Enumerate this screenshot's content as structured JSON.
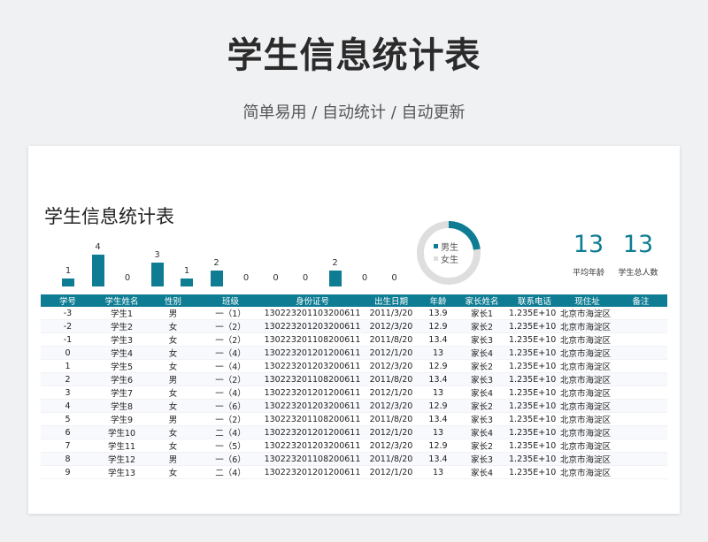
{
  "header": {
    "title": "学生信息统计表",
    "subtitle": "简单易用 / 自动统计 / 自动更新"
  },
  "sheet": {
    "title": "学生信息统计表"
  },
  "chart_data": [
    {
      "type": "bar",
      "values": [
        1,
        4,
        0,
        3,
        1,
        2,
        0,
        0,
        0,
        2,
        0,
        0
      ],
      "color": "#0e7c93"
    },
    {
      "type": "pie",
      "labels": [
        "男生",
        "女生"
      ],
      "values": [
        3,
        10
      ],
      "colors": [
        "#0e7c93",
        "#dedede"
      ]
    }
  ],
  "stats": {
    "avg_age_value": "13",
    "avg_age_label": "平均年龄",
    "total_value": "13",
    "total_label": "学生总人数"
  },
  "table": {
    "columns": [
      "学号",
      "学生姓名",
      "性别",
      "班级",
      "身份证号",
      "出生日期",
      "年龄",
      "家长姓名",
      "联系电话",
      "现住址",
      "备注"
    ],
    "rows": [
      [
        "-3",
        "学生1",
        "男",
        "一（1）",
        "130223201103200611",
        "2011/3/20",
        "13.9",
        "家长1",
        "1.235E+10",
        "北京市海淀区",
        ""
      ],
      [
        "-2",
        "学生2",
        "女",
        "一（2）",
        "130223201203200611",
        "2012/3/20",
        "12.9",
        "家长2",
        "1.235E+10",
        "北京市海淀区",
        ""
      ],
      [
        "-1",
        "学生3",
        "女",
        "一（2）",
        "130223201108200611",
        "2011/8/20",
        "13.4",
        "家长3",
        "1.235E+10",
        "北京市海淀区",
        ""
      ],
      [
        "0",
        "学生4",
        "女",
        "一（4）",
        "130223201201200611",
        "2012/1/20",
        "13",
        "家长4",
        "1.235E+10",
        "北京市海淀区",
        ""
      ],
      [
        "1",
        "学生5",
        "女",
        "一（4）",
        "130223201203200611",
        "2012/3/20",
        "12.9",
        "家长2",
        "1.235E+10",
        "北京市海淀区",
        ""
      ],
      [
        "2",
        "学生6",
        "男",
        "一（2）",
        "130223201108200611",
        "2011/8/20",
        "13.4",
        "家长3",
        "1.235E+10",
        "北京市海淀区",
        ""
      ],
      [
        "3",
        "学生7",
        "女",
        "一（4）",
        "130223201201200611",
        "2012/1/20",
        "13",
        "家长4",
        "1.235E+10",
        "北京市海淀区",
        ""
      ],
      [
        "4",
        "学生8",
        "女",
        "一（6）",
        "130223201203200611",
        "2012/3/20",
        "12.9",
        "家长2",
        "1.235E+10",
        "北京市海淀区",
        ""
      ],
      [
        "5",
        "学生9",
        "男",
        "一（2）",
        "130223201108200611",
        "2011/8/20",
        "13.4",
        "家长3",
        "1.235E+10",
        "北京市海淀区",
        ""
      ],
      [
        "6",
        "学生10",
        "女",
        "二（4）",
        "130223201201200611",
        "2012/1/20",
        "13",
        "家长4",
        "1.235E+10",
        "北京市海淀区",
        ""
      ],
      [
        "7",
        "学生11",
        "女",
        "一（5）",
        "130223201203200611",
        "2012/3/20",
        "12.9",
        "家长2",
        "1.235E+10",
        "北京市海淀区",
        ""
      ],
      [
        "8",
        "学生12",
        "男",
        "一（6）",
        "130223201108200611",
        "2011/8/20",
        "13.4",
        "家长3",
        "1.235E+10",
        "北京市海淀区",
        ""
      ],
      [
        "9",
        "学生13",
        "女",
        "二（4）",
        "130223201201200611",
        "2012/1/20",
        "13",
        "家长4",
        "1.235E+10",
        "北京市海淀区",
        ""
      ]
    ]
  }
}
